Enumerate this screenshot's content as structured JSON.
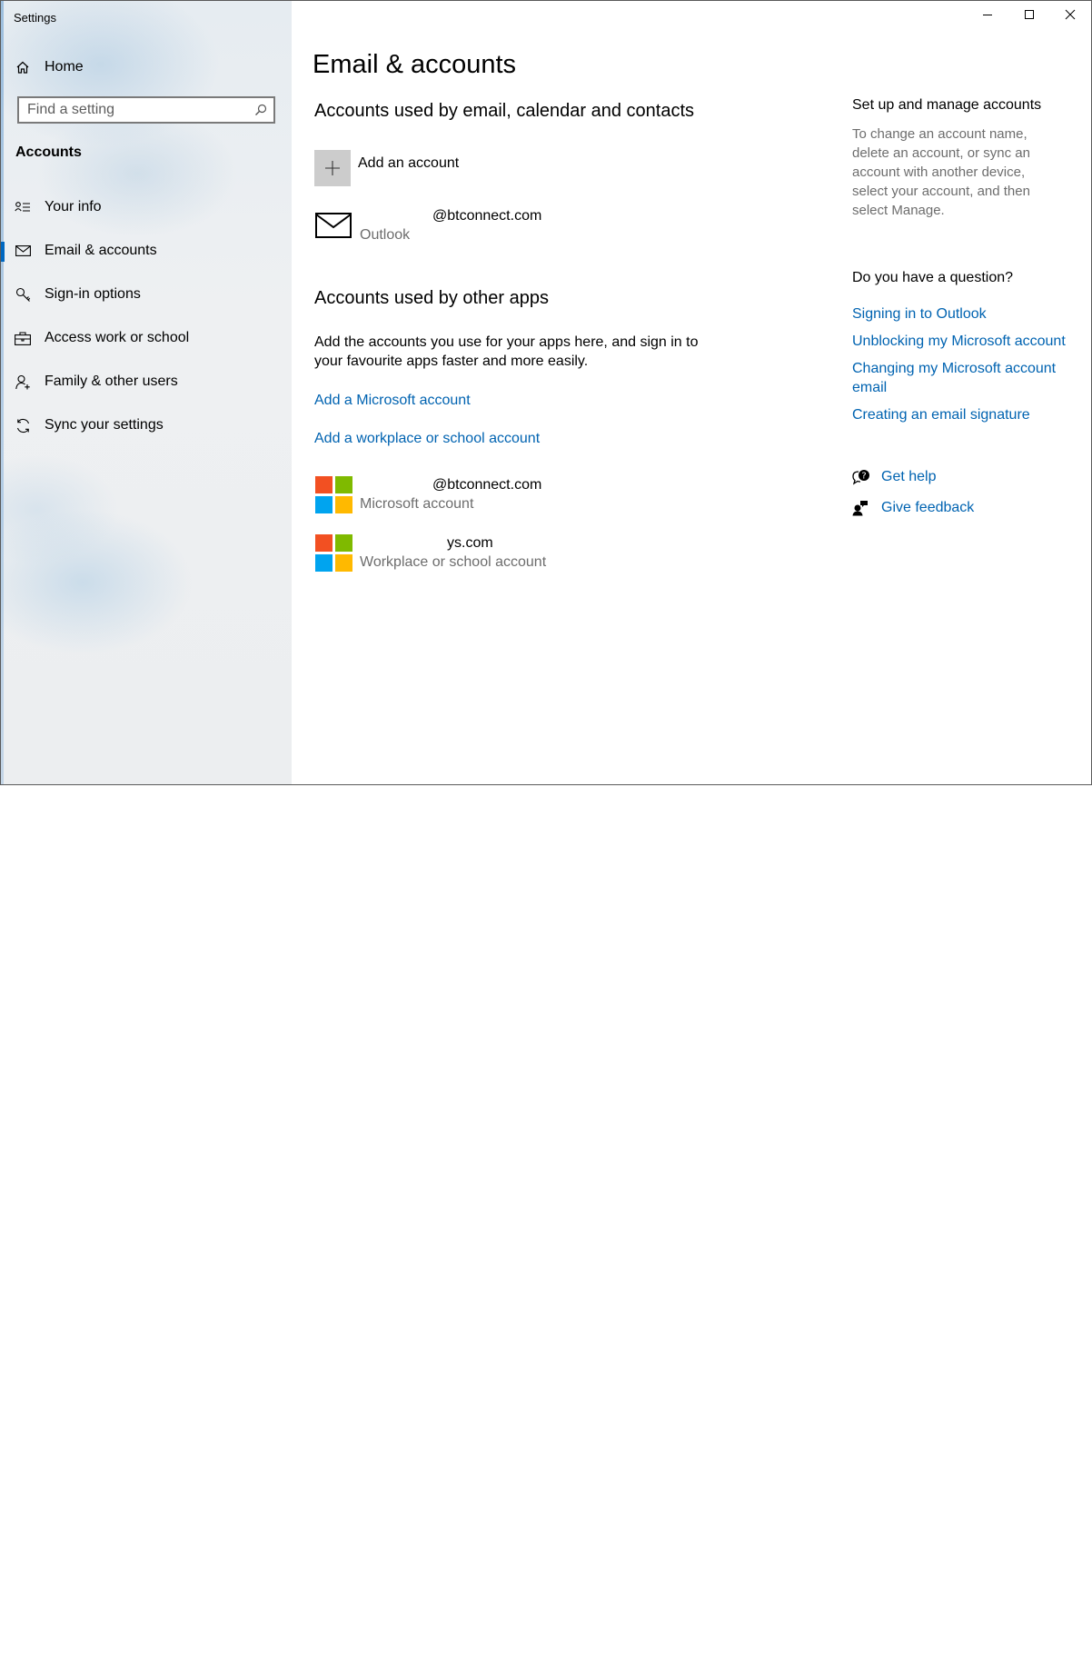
{
  "window": {
    "title": "Settings"
  },
  "colors": {
    "accent": "#0063b1",
    "selected_indicator": "#0067c0",
    "secondary_text": "#6d6d6d",
    "ms_red": "#f25022",
    "ms_green": "#7fba00",
    "ms_blue": "#00a4ef",
    "ms_yellow": "#ffb900"
  },
  "sidebar": {
    "home_label": "Home",
    "search_placeholder": "Find a setting",
    "section_label": "Accounts",
    "items": [
      {
        "label": "Your info",
        "icon": "contact-info-icon"
      },
      {
        "label": "Email & accounts",
        "icon": "mail-icon",
        "selected": true
      },
      {
        "label": "Sign-in options",
        "icon": "key-icon"
      },
      {
        "label": "Access work or school",
        "icon": "briefcase-icon"
      },
      {
        "label": "Family & other users",
        "icon": "add-person-icon"
      },
      {
        "label": "Sync your settings",
        "icon": "sync-icon"
      }
    ]
  },
  "main": {
    "title": "Email & accounts",
    "email_section": {
      "heading": "Accounts used by email, calendar and contacts",
      "add_account_label": "Add an account",
      "accounts": [
        {
          "email": "@btconnect.com",
          "type": "Outlook"
        }
      ]
    },
    "apps_section": {
      "heading": "Accounts used by other apps",
      "description": "Add the accounts you use for your apps here, and sign in to your favourite apps faster and more easily.",
      "add_microsoft_label": "Add a Microsoft account",
      "add_workplace_label": "Add a workplace or school account",
      "accounts": [
        {
          "email": "@btconnect.com",
          "type": "Microsoft account"
        },
        {
          "email": "ys.com",
          "type": "Workplace or school account"
        }
      ]
    }
  },
  "right_panel": {
    "manage_heading": "Set up and manage accounts",
    "manage_text": "To change an account name, delete an account, or sync an account with another device, select your account, and then select Manage.",
    "question_heading": "Do you have a question?",
    "links": [
      "Signing in to Outlook",
      "Unblocking my Microsoft account",
      "Changing my Microsoft account email",
      "Creating an email signature"
    ],
    "get_help_label": "Get help",
    "feedback_label": "Give feedback"
  }
}
